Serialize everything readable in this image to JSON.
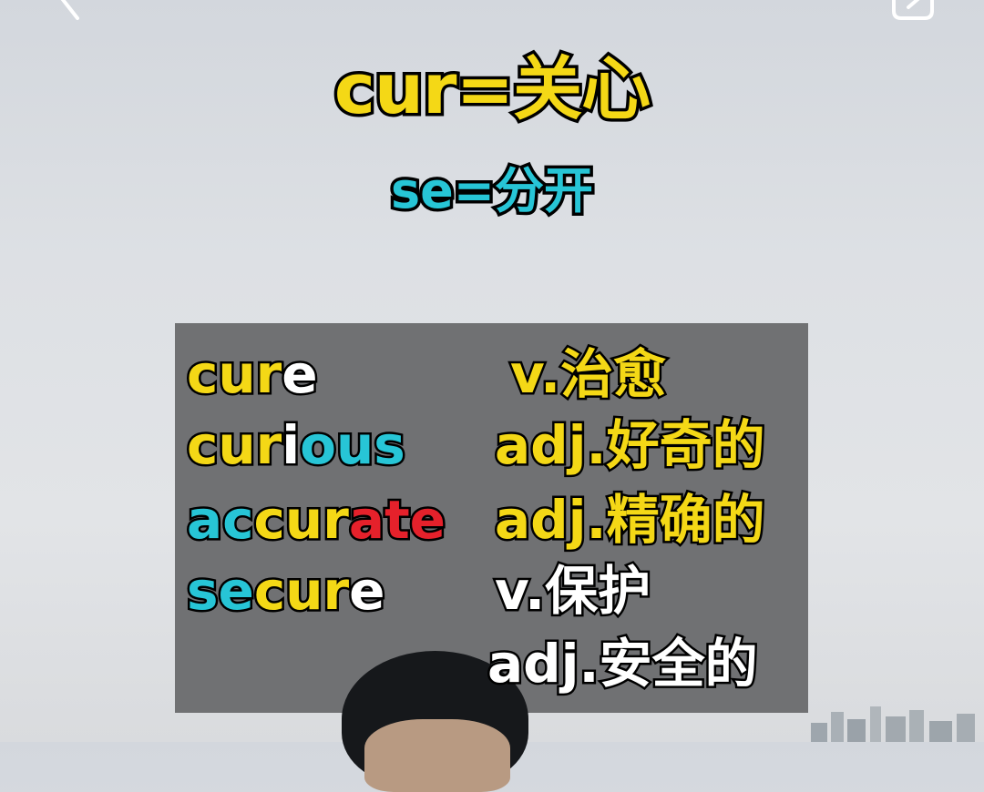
{
  "title": "cur=关心",
  "subtitle": "se=分开",
  "rows": [
    {
      "word_parts": [
        {
          "text": "cur",
          "color": "yellow"
        },
        {
          "text": "e",
          "color": "white"
        }
      ],
      "meaning": "v.治愈",
      "meaning_color": "yellow"
    },
    {
      "word_parts": [
        {
          "text": "cur",
          "color": "yellow"
        },
        {
          "text": "i",
          "color": "white"
        },
        {
          "text": "ous",
          "color": "cyan"
        }
      ],
      "meaning": "adj.好奇的",
      "meaning_color": "yellow"
    },
    {
      "word_parts": [
        {
          "text": "ac",
          "color": "cyan"
        },
        {
          "text": "cur",
          "color": "yellow"
        },
        {
          "text": "ate",
          "color": "red"
        }
      ],
      "meaning": "adj.精确的",
      "meaning_color": "yellow"
    },
    {
      "word_parts": [
        {
          "text": "se",
          "color": "cyan"
        },
        {
          "text": "cur",
          "color": "yellow"
        },
        {
          "text": "e",
          "color": "white"
        }
      ],
      "meaning": "v.保护",
      "meaning_color": "white"
    },
    {
      "word_parts": [],
      "meaning": "adj.安全的",
      "meaning_color": "white"
    }
  ],
  "colors": {
    "yellow": "#f4d816",
    "cyan": "#27c5d6",
    "white": "#ffffff",
    "red": "#e5212b",
    "panel": "#6d6e70"
  },
  "icons": {
    "back": "back-arrow-icon",
    "share": "share-icon"
  }
}
